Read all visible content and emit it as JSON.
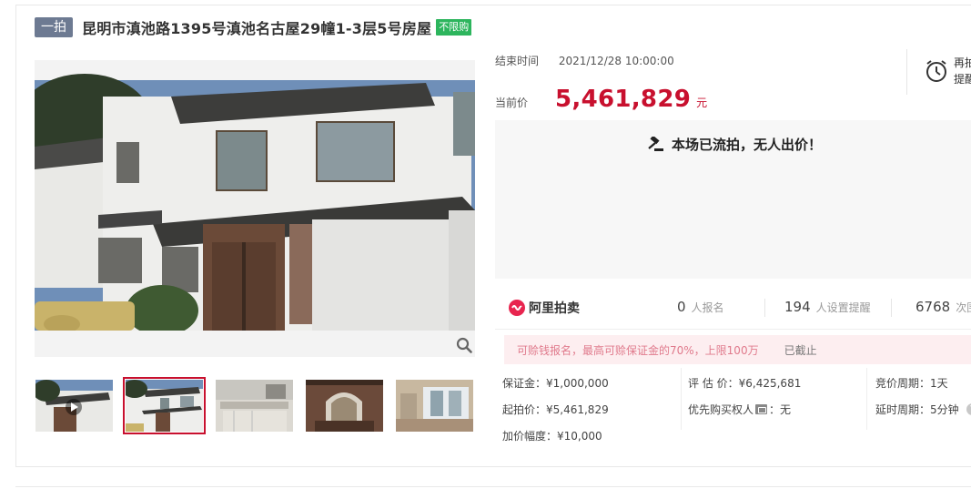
{
  "header": {
    "round_badge": "一拍",
    "title": "昆明市滇池路1395号滇池名古屋29幢1-3层5号房屋",
    "limit_badge": "不限购"
  },
  "auction": {
    "end_label": "结束时间",
    "end_time": "2021/12/28 10:00:00",
    "price_label": "当前价",
    "price": "5,461,829",
    "price_unit": "元",
    "reminder_label": "再拍提醒",
    "status_message": "本场已流拍，无人出价！"
  },
  "stats": {
    "logo_text": "阿里拍卖",
    "registrations_num": "0",
    "registrations_label": "人报名",
    "reminders_num": "194",
    "reminders_label": "人设置提醒",
    "views_num": "6768",
    "views_label": "次围观"
  },
  "deposit": {
    "message": "可赊钱报名，最高可赊保证金的70%，上限100万",
    "status": "已截止"
  },
  "details": {
    "deposit": "保证金：¥1,000,000",
    "start_price": "起拍价：¥5,461,829",
    "increment": "加价幅度：¥10,000",
    "appraisal": "评 估 价：¥6,425,681",
    "priority_prefix": "优先购买权人",
    "priority_value": "：无",
    "bid_cycle": "竞价周期：1天",
    "delay_cycle": "延时周期：5分钟",
    "help_symbol": "?"
  },
  "icons": {
    "zoom": "magnifier-icon",
    "alarm": "alarm-clock-icon",
    "gavel": "gavel-icon",
    "help": "help-icon",
    "video": "play-icon"
  },
  "colors": {
    "price": "#c8102e",
    "badge_round": "#6d7a92",
    "badge_limit": "#2db55d",
    "logo": "#e8254f",
    "deposit_text": "#e07a8c"
  },
  "gallery": {
    "thumbnail_count": 5,
    "active_index": 1
  }
}
